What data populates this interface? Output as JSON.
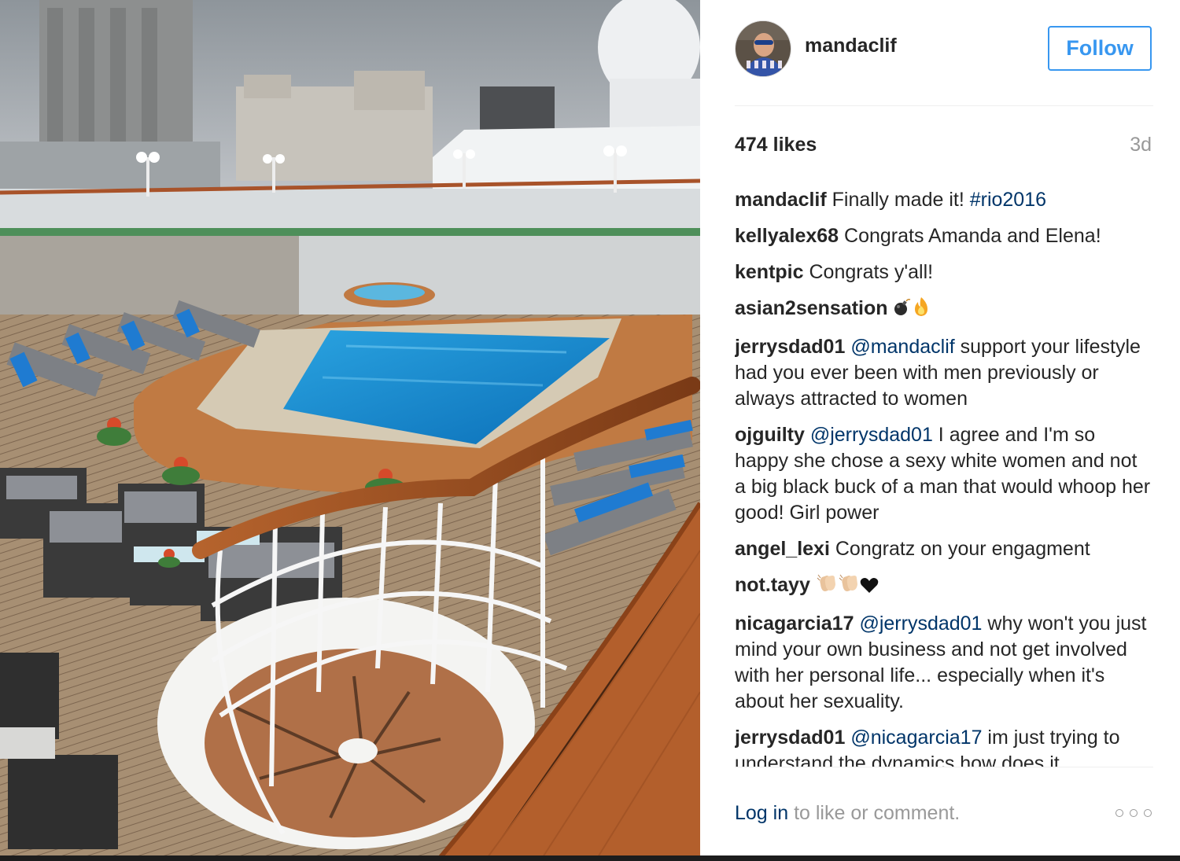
{
  "post": {
    "photo_label": "Cruise ship pool deck with spiral staircase",
    "username": "mandaclif",
    "follow_label": "Follow",
    "likes": "474 likes",
    "time_ago": "3d"
  },
  "comments": [
    {
      "user": "mandaclif",
      "parts": [
        {
          "text": "Finally made it! "
        },
        {
          "text": "#rio2016",
          "mention": true
        }
      ]
    },
    {
      "user": "kellyalex68",
      "parts": [
        {
          "text": "Congrats Amanda and Elena!"
        }
      ]
    },
    {
      "user": "kentpic",
      "parts": [
        {
          "text": "Congrats y'all!"
        }
      ]
    },
    {
      "user": "asian2sensation",
      "parts": [
        {
          "text": " "
        }
      ],
      "emoji": [
        "bomb-emoji",
        "fire-emoji"
      ]
    },
    {
      "user": "jerrysdad01",
      "parts": [
        {
          "text": "@mandaclif",
          "mention": true
        },
        {
          "text": " support your lifestyle had you ever been with men previously or always attracted to women"
        }
      ]
    },
    {
      "user": "ojguilty",
      "parts": [
        {
          "text": "@jerrysdad01",
          "mention": true
        },
        {
          "text": " I agree and I'm so happy she chose a sexy white women and not a big black buck of a man that would whoop her good! Girl power"
        }
      ]
    },
    {
      "user": "angel_lexi",
      "parts": [
        {
          "text": "Congratz on your engagment"
        }
      ]
    },
    {
      "user": "not.tayy",
      "parts": [
        {
          "text": " "
        }
      ],
      "emoji": [
        "clapping-hands-emoji",
        "clapping-hands-emoji",
        "heart-emoji"
      ]
    },
    {
      "user": "nicagarcia17",
      "parts": [
        {
          "text": "@jerrysdad01",
          "mention": true
        },
        {
          "text": " why won't you just mind your own business and not get involved with her personal life... especially when it's about her sexuality."
        }
      ]
    },
    {
      "user": "jerrysdad01",
      "parts": [
        {
          "text": "@nicagarcia17",
          "mention": true
        },
        {
          "text": " im just trying to understand the dynamics how does it"
        }
      ]
    }
  ],
  "footer": {
    "login_link": "Log in",
    "login_rest": " to like or comment."
  },
  "colors": {
    "accent": "#3897f0",
    "link": "#003569",
    "muted": "#999999",
    "text": "#262626"
  }
}
